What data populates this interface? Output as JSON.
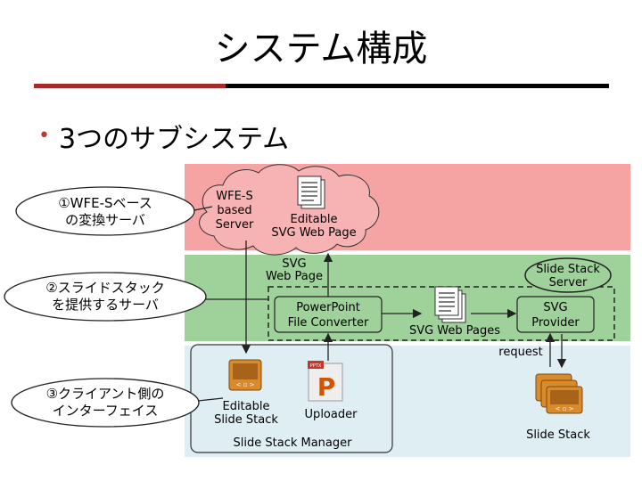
{
  "slide": {
    "title": "システム構成",
    "bullet": "3つのサブシステム"
  },
  "callouts": [
    {
      "line1": "①WFE-Sベース",
      "line2": "の変換サーバ"
    },
    {
      "line1": "②スライドスタック",
      "line2": "を提供するサーバ"
    },
    {
      "line1": "③クライアント側の",
      "line2": "インターフェイス"
    }
  ],
  "diagram": {
    "wfe_cloud": {
      "line1": "WFE-S",
      "line2": "based",
      "line3": "Server"
    },
    "editable_svg_page": {
      "line1": "Editable",
      "line2": "SVG Web Page"
    },
    "svg_web_page_label": {
      "line1": "SVG",
      "line2": "Web Page"
    },
    "slide_stack_server": {
      "line1": "Slide Stack",
      "line2": "Server"
    },
    "ppt_converter": {
      "line1": "PowerPoint",
      "line2": "File Converter"
    },
    "svg_web_pages": "SVG Web Pages",
    "svg_provider": {
      "line1": "SVG",
      "line2": "Provider"
    },
    "request_label": "request",
    "editable_slide_stack": {
      "line1": "Editable",
      "line2": "Slide Stack"
    },
    "uploader": "Uploader",
    "uploader_badge": "PPTX",
    "slide_stack_manager": "Slide Stack Manager",
    "slide_stack": "Slide Stack"
  },
  "colors": {
    "band_top": "#f5a3a3",
    "band_middle": "#9fd29b",
    "band_bottom": "#dfeef2",
    "title_rule_red": "#a52a2a",
    "bullet": "#c0392b"
  }
}
